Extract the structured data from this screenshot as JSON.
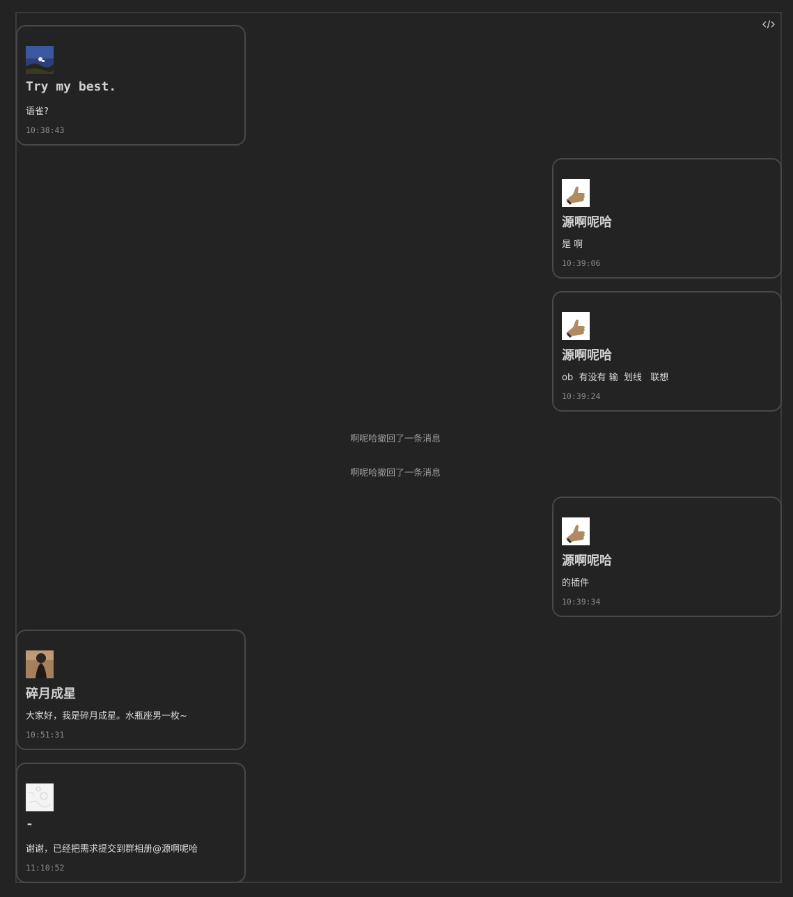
{
  "toolbar": {
    "code_icon": "code-icon"
  },
  "messages": [
    {
      "name": "Try my best.",
      "text": "语雀?",
      "time": "10:38:43",
      "avatar": "night-sky-avatar"
    },
    {
      "name": "源啊呢哈",
      "text": "是 啊",
      "time": "10:39:06",
      "avatar": "thumbs-up-avatar"
    },
    {
      "name": "源啊呢哈",
      "text": "ob  有没有 输  划线   联想",
      "time": "10:39:24",
      "avatar": "thumbs-up-avatar"
    },
    {
      "name": "源啊呢哈",
      "text": "的插件",
      "time": "10:39:34",
      "avatar": "thumbs-up-avatar"
    },
    {
      "name": "碎月成星",
      "text": "大家好，我是碎月成星。水瓶座男一枚~",
      "time": "10:51:31",
      "avatar": "person-photo-avatar"
    },
    {
      "name": "-",
      "text": "谢谢，已经把需求提交到群相册@源啊呢哈",
      "time": "11:10:52",
      "avatar": "sketch-avatar"
    }
  ],
  "system": [
    {
      "text": "啊呢哈撤回了一条消息"
    },
    {
      "text": "啊呢哈撤回了一条消息"
    }
  ]
}
